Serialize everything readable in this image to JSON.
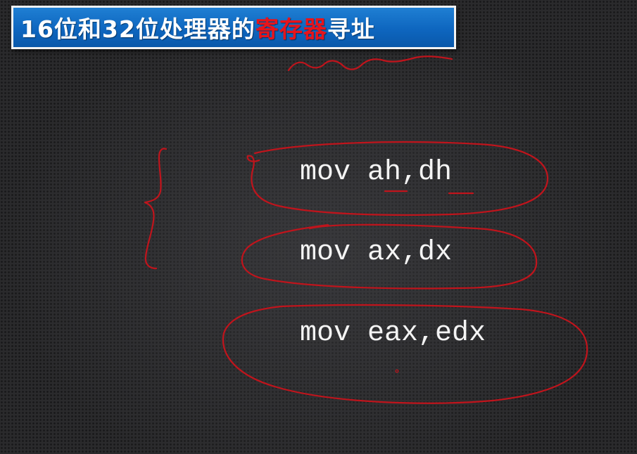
{
  "title": {
    "prefix": "16位和32位处理器的",
    "highlight": "寄存器",
    "suffix": "寻址"
  },
  "code_lines": [
    "mov ah,dh",
    "mov ax,dx",
    "mov eax,edx"
  ],
  "colors": {
    "banner_blue": "#0e66bf",
    "highlight_red": "#e8141b",
    "annotation_red": "#c0141c",
    "background": "#2a2a2c"
  }
}
